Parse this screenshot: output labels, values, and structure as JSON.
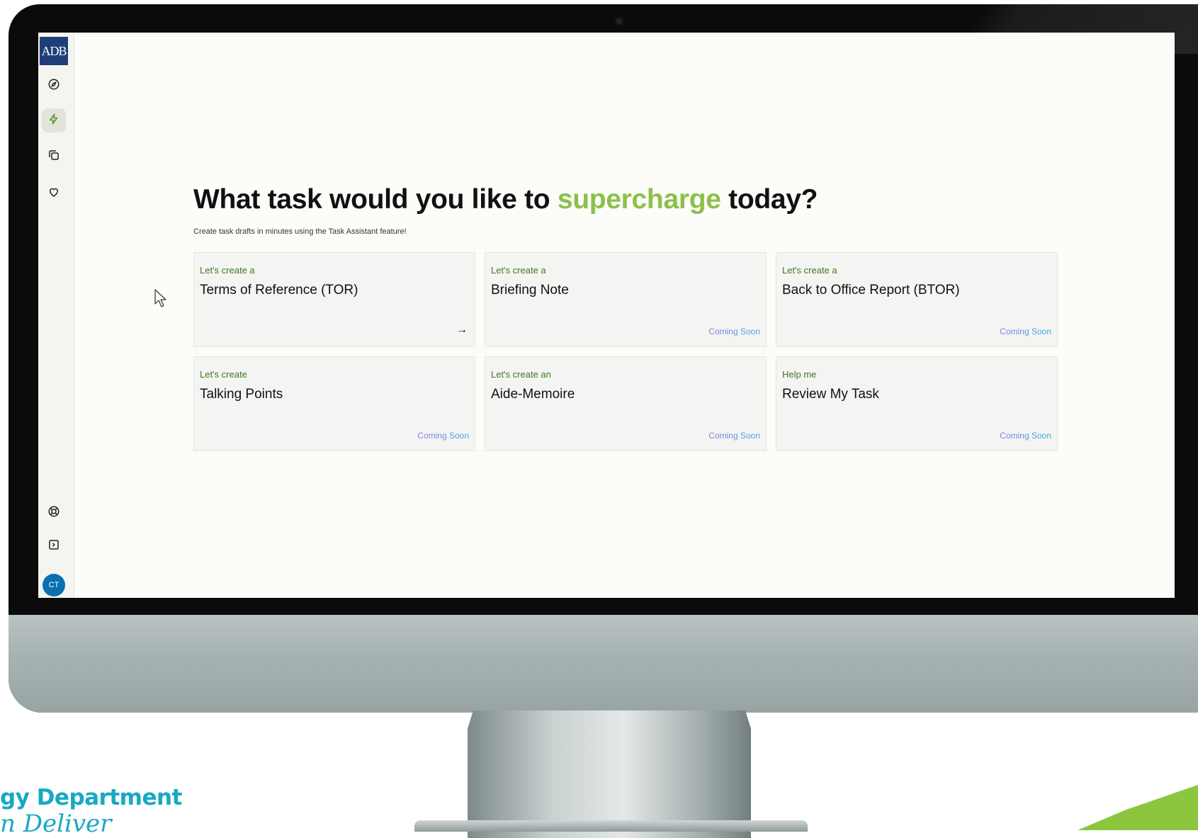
{
  "sidebar": {
    "logo": "ADB",
    "nav": [
      {
        "icon": "compass-icon"
      },
      {
        "icon": "bolt-icon",
        "active": true
      },
      {
        "icon": "copy-icon"
      },
      {
        "icon": "heart-icon"
      }
    ],
    "bottom": [
      {
        "icon": "lifebuoy-icon"
      },
      {
        "icon": "panel-toggle-icon"
      }
    ],
    "avatar_initials": "CT"
  },
  "main": {
    "headline_before": "What task would you like to ",
    "headline_accent": "supercharge",
    "headline_after": " today?",
    "subline": "Create task drafts in minutes using the Task Assistant feature!",
    "cards": [
      {
        "eyebrow": "Let's create a",
        "title": "Terms of Reference (TOR)",
        "action": "→"
      },
      {
        "eyebrow": "Let's create a",
        "title": "Briefing Note",
        "badge": "Coming Soon"
      },
      {
        "eyebrow": "Let's create a",
        "title": "Back to Office Report (BTOR)",
        "badge": "Coming Soon"
      },
      {
        "eyebrow": "Let's create",
        "title": "Talking Points",
        "badge": "Coming Soon"
      },
      {
        "eyebrow": "Let's create an",
        "title": "Aide-Memoire",
        "badge": "Coming Soon"
      },
      {
        "eyebrow": "Help me",
        "title": "Review My Task",
        "badge": "Coming Soon"
      }
    ]
  },
  "footer": {
    "department": "gy Department",
    "tagline": "n Deliver"
  },
  "colors": {
    "accent": "#8cc04b",
    "eyebrow": "#3d7a1f",
    "brand_blue": "#1f3f78",
    "avatar": "#0b6fb1"
  }
}
